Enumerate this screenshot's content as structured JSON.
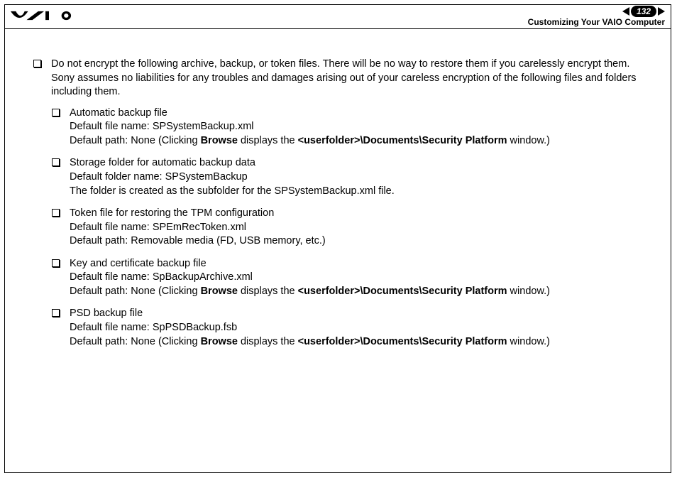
{
  "header": {
    "page_number": "132",
    "section_title": "Customizing Your VAIO Computer"
  },
  "intro": {
    "line1": "Do not encrypt the following archive, backup, or token files. There will be no way to restore them if you carelessly encrypt them.",
    "line2": "Sony assumes no liabilities for any troubles and damages arising out of your careless encryption of the following files and folders including them."
  },
  "items": [
    {
      "title": "Automatic backup file",
      "l2": "Default file name: SPSystemBackup.xml",
      "l3_pre": "Default path: None (Clicking ",
      "l3_b1": "Browse",
      "l3_mid": " displays the ",
      "l3_b2": "<userfolder>\\Documents\\Security Platform",
      "l3_post": " window.)"
    },
    {
      "title": "Storage folder for automatic backup data",
      "l2": "Default folder name: SPSystemBackup",
      "l3_plain": "The folder is created as the subfolder for the SPSystemBackup.xml file."
    },
    {
      "title": "Token file for restoring the TPM configuration",
      "l2": "Default file name: SPEmRecToken.xml",
      "l3_plain": "Default path: Removable media (FD, USB memory, etc.)"
    },
    {
      "title": "Key and certificate backup file",
      "l2": "Default file name: SpBackupArchive.xml",
      "l3_pre": "Default path: None (Clicking ",
      "l3_b1": "Browse",
      "l3_mid": " displays the ",
      "l3_b2": "<userfolder>\\Documents\\Security Platform",
      "l3_post": " window.)"
    },
    {
      "title": "PSD backup file",
      "l2": "Default file name: SpPSDBackup.fsb",
      "l3_pre": "Default path: None (Clicking ",
      "l3_b1": "Browse",
      "l3_mid": " displays the ",
      "l3_b2": "<userfolder>\\Documents\\Security Platform",
      "l3_post": " window.)"
    }
  ]
}
